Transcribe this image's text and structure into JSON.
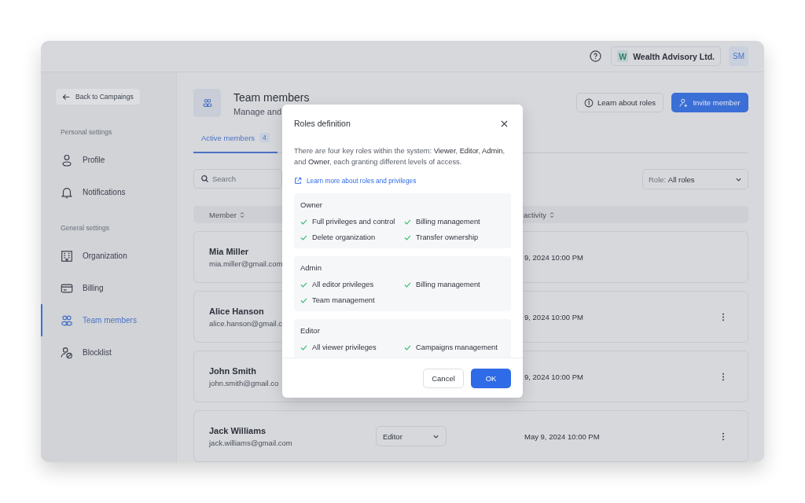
{
  "topbar": {
    "organization": {
      "initial": "W",
      "name": "Wealth Advisory Ltd."
    },
    "avatar": "SM"
  },
  "sidebar": {
    "back_button": "Back to Campaings",
    "sections": [
      {
        "title": "Personal settings",
        "items": [
          {
            "label": "Profile",
            "selected": false
          },
          {
            "label": "Notifications",
            "selected": false
          }
        ]
      },
      {
        "title": "General settings",
        "items": [
          {
            "label": "Organization",
            "selected": false
          },
          {
            "label": "Billing",
            "selected": false
          },
          {
            "label": "Team members",
            "selected": true
          },
          {
            "label": "Blocklist",
            "selected": false
          }
        ]
      }
    ]
  },
  "page": {
    "title": "Team members",
    "subtitle": "Manage and",
    "learn_button": "Learn about roles",
    "invite_button": "Invite member"
  },
  "tabs": [
    {
      "label": "Active members",
      "count": "4",
      "selected": true
    }
  ],
  "search": {
    "placeholder": "Search"
  },
  "role_filter": {
    "label": "Role:",
    "value": "All roles"
  },
  "table": {
    "columns": [
      "Member",
      "activity"
    ],
    "rows": [
      {
        "name": "Mia Miller",
        "email": "mia.miller@gmail.com",
        "last_activity": "9, 2024 10:00 PM",
        "menu": false
      },
      {
        "name": "Alice Hanson",
        "email": "alice.hanson@gmail.c",
        "last_activity": "9, 2024 10:00 PM",
        "menu": true
      },
      {
        "name": "John Smith",
        "email": "john.smith@gmail.co",
        "last_activity": "9, 2024 10:00 PM",
        "menu": true
      },
      {
        "name": "Jack Williams",
        "email": "jack.williams@gmail.com",
        "role": "Editor",
        "last_activity": "May 9, 2024 10:00 PM",
        "menu": true
      }
    ]
  },
  "dialog": {
    "title": "Roles definition",
    "text": "There are four key roles within the system: **Viewer**, **Editor**, **Admin**, and **Owner**, each granting different levels of access.",
    "link": "Learn more about roles and privileges",
    "roles": [
      {
        "name": "Owner",
        "privileges": [
          "Full privileges and control",
          "Billing management",
          "Delete organization",
          "Transfer ownership"
        ]
      },
      {
        "name": "Admin",
        "privileges": [
          "All editor privileges",
          "Billing management",
          "Team management"
        ]
      },
      {
        "name": "Editor",
        "privileges": [
          "All viewer privileges",
          "Campaigns management"
        ]
      }
    ],
    "buttons": [
      {
        "label": "Cancel",
        "kind": "secondary"
      },
      {
        "label": "OK",
        "kind": "primary"
      }
    ]
  }
}
